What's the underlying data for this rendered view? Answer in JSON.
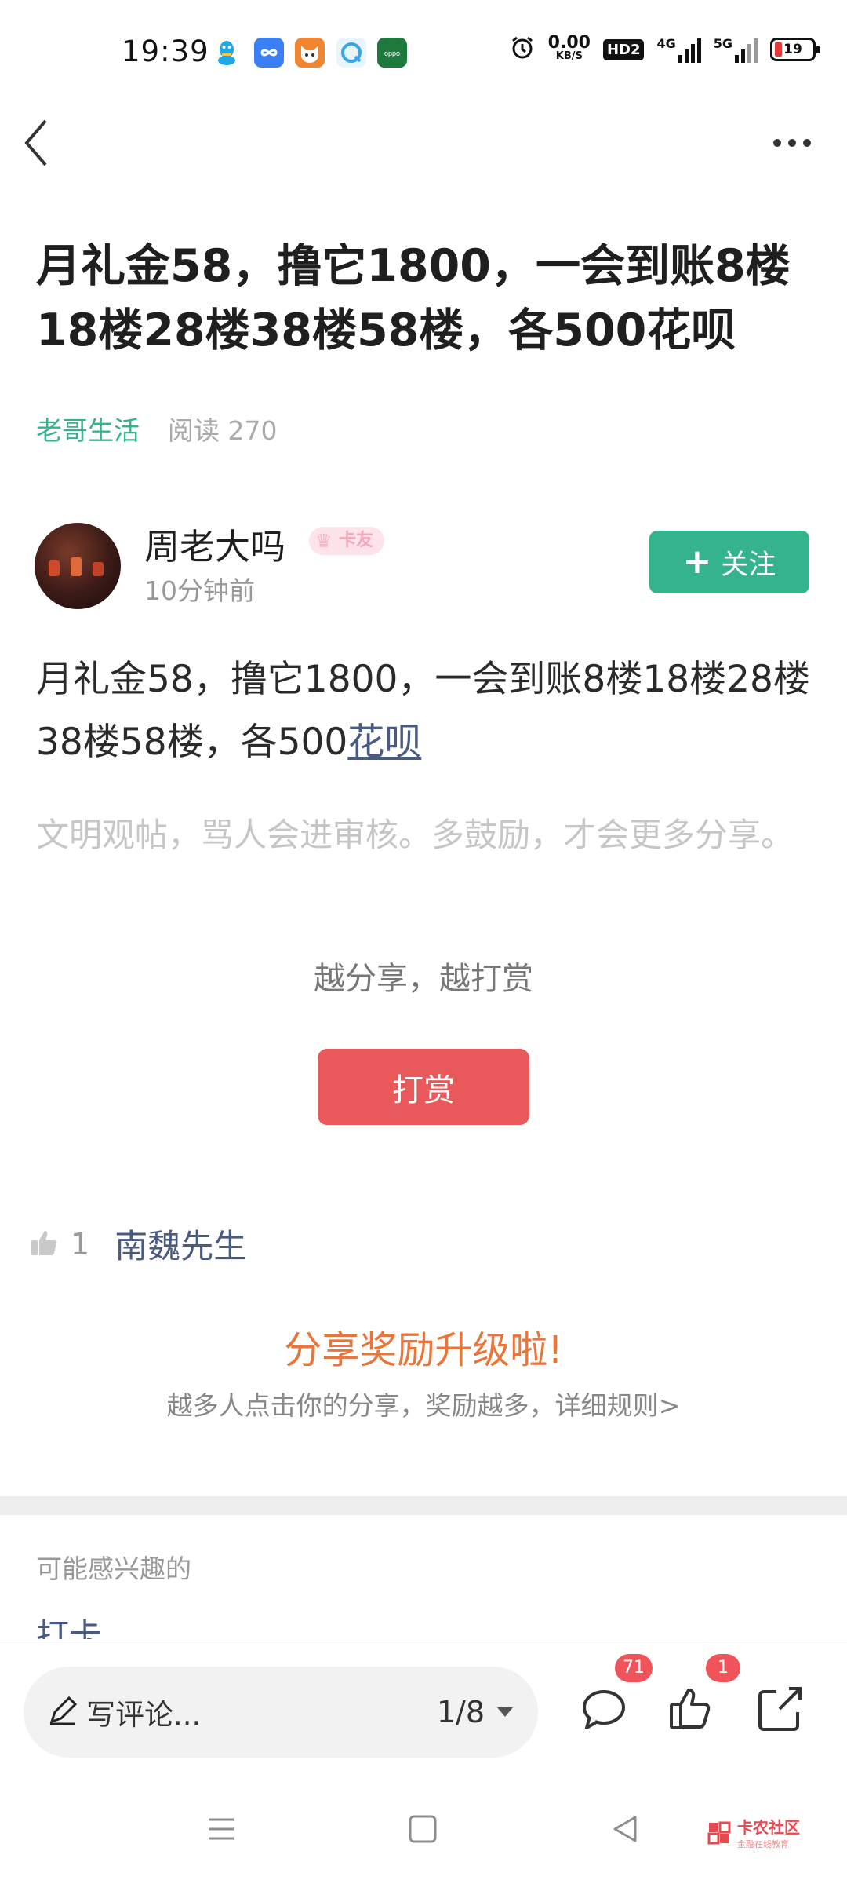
{
  "status_bar": {
    "time": "19:39",
    "net_speed_value": "0.00",
    "net_speed_unit": "KB/S",
    "hd_label": "HD2",
    "signal1_label": "4G",
    "signal2_label": "5G",
    "battery": "19",
    "app_icons": [
      {
        "name": "qq-icon",
        "color": "#1fa7e8"
      },
      {
        "name": "infinity-app-icon",
        "color": "#3b7ff5"
      },
      {
        "name": "fox-app-icon",
        "color": "#f2852f"
      },
      {
        "name": "browser-app-icon",
        "color": "#6fc3f0"
      },
      {
        "name": "oppo-app-icon",
        "color": "#1e7a3c"
      }
    ]
  },
  "header": {
    "back_icon": "chevron-left-icon",
    "more_icon": "more-dots-icon"
  },
  "post": {
    "title": "月礼金58，撸它1800，一会到账8楼18楼28楼38楼58楼，各500花呗",
    "category": "老哥生活",
    "reads": "阅读 270",
    "author": {
      "name": "周老大吗",
      "badge": "卡友",
      "time": "10分钟前"
    },
    "follow_label": "关注",
    "body_prefix": "月礼金58，撸它1800，一会到账8楼18楼28楼38楼58楼，各500",
    "body_link": "花呗",
    "hint": "文明观帖，骂人会进审核。多鼓励，才会更多分享。"
  },
  "reward": {
    "caption": "越分享，越打赏",
    "button_label": "打赏"
  },
  "likes": {
    "count": "1",
    "users": "南魏先生"
  },
  "share_promo": {
    "title": "分享奖励升级啦!",
    "subtitle": "越多人点击你的分享，奖励越多，详细规则>"
  },
  "interest": {
    "label": "可能感兴趣的",
    "first_item": "打卡"
  },
  "bottom_bar": {
    "comment_placeholder": "写评论...",
    "page_indicator": "1/8",
    "comment_count": "71",
    "like_count": "1"
  },
  "watermark": {
    "main": "卡农社区",
    "sub": "金融在线教育"
  },
  "colors": {
    "accent_green": "#35b38d",
    "reward_red": "#e9585a",
    "promo_orange": "#e8763a",
    "link_blue": "#4a5b82",
    "badge_red": "#f0545a"
  }
}
